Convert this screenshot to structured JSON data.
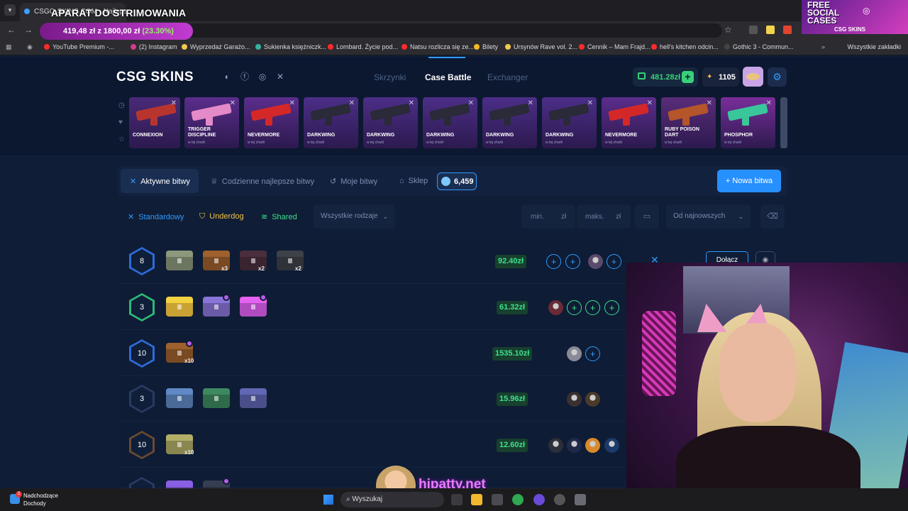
{
  "browser": {
    "tab_title": "CSGO-SKINS.COM - Najlepsze s",
    "stream_title": "APARAT DO STRIMOWANIA",
    "goal_progress": {
      "text": "419,48 zł z 1800,00 zł",
      "percent": "(23.30%)"
    },
    "bookmarks": [
      {
        "label": "YouTube Premium -...",
        "color": "#ff2a2a"
      },
      {
        "label": "(2) Instagram",
        "color": "#d23c8a"
      },
      {
        "label": "Wyprzedaż Garażo...",
        "color": "#f2c94c"
      },
      {
        "label": "Sukienka księżniczk...",
        "color": "#36b3a0"
      },
      {
        "label": "Lombard. Życie pod...",
        "color": "#ff2a2a"
      },
      {
        "label": "Natsu rozlicza się ze...",
        "color": "#ff2a2a"
      },
      {
        "label": "Bilety",
        "color": "#f5b921"
      },
      {
        "label": "Ursynów Rave vol. 2...",
        "color": "#f2c94c"
      },
      {
        "label": "Cennik – Mam Frajd...",
        "color": "#ff2a2a"
      },
      {
        "label": "hell's kitchen odcin...",
        "color": "#ff2a2a"
      },
      {
        "label": "Gothic 3 - Commun...",
        "color": "#444"
      }
    ],
    "all_bookmarks": "Wszystkie zakładki"
  },
  "promo": {
    "title": "FREE SOCIAL CASES",
    "brand": "CSG SKINS"
  },
  "header": {
    "logo": "CSG SKINS",
    "nav": [
      "Skrzynki",
      "Case Battle",
      "Exchanger"
    ],
    "active_nav": "Case Battle",
    "balance": "481.28zł",
    "coins": "1105"
  },
  "drops": [
    {
      "name": "CONNEXION",
      "sub": "",
      "gun": "#b8352f",
      "bg": "#4a2a78"
    },
    {
      "name": "TRIGGER DISCIPLINE",
      "sub": "w tej chwili",
      "gun": "#e58ac8",
      "bg": "#5b2d8c"
    },
    {
      "name": "NEVERMORE",
      "sub": "w tej chwili",
      "gun": "#d42828",
      "bg": "#5b2d8c"
    },
    {
      "name": "DARKWING",
      "sub": "w tej chwili",
      "gun": "#2a2a38",
      "bg": "#4c2e88"
    },
    {
      "name": "DARKWING",
      "sub": "w tej chwili",
      "gun": "#2a2a38",
      "bg": "#4c2e88"
    },
    {
      "name": "DARKWING",
      "sub": "w tej chwili",
      "gun": "#2a2a38",
      "bg": "#4c2e88"
    },
    {
      "name": "DARKWING",
      "sub": "w tej chwili",
      "gun": "#2a2a38",
      "bg": "#4c2e88"
    },
    {
      "name": "DARKWING",
      "sub": "w tej chwili",
      "gun": "#2a2a38",
      "bg": "#4c2e88"
    },
    {
      "name": "NEVERMORE",
      "sub": "w tej chwili",
      "gun": "#d42828",
      "bg": "#5b2d8c"
    },
    {
      "name": "RUBY POISON DART",
      "sub": "w tej chwili",
      "gun": "#b5552a",
      "bg": "#5a2c7a"
    },
    {
      "name": "PHOSPHOR",
      "sub": "w tej chwili",
      "gun": "#39c69a",
      "bg": "#7a2e9a"
    }
  ],
  "battles": {
    "tabs": [
      "Aktywne bitwy",
      "Codzienne najlepsze bitwy",
      "Moje bitwy",
      "Sklep"
    ],
    "gems": "6,459",
    "new_battle": "Nowa bitwa",
    "filters": {
      "standard": "Standardowy",
      "underdog": "Underdog",
      "shared": "Shared"
    },
    "type_select": "Wszystkie rodzaje",
    "min_placeholder": "min.",
    "max_placeholder": "maks.",
    "currency": "zł",
    "sort": "Od najnowszych",
    "join": "Dołącz",
    "rows": [
      {
        "rounds": "8",
        "price": "92.40zł",
        "hex": "#2e6bd8",
        "cases": [
          {
            "c": "#6c7560"
          },
          {
            "c": "#7a4a22",
            "m": "x3"
          },
          {
            "c": "#3a2430",
            "m": "x2"
          },
          {
            "c": "#2f3238",
            "m": "x2"
          }
        ]
      },
      {
        "rounds": "3",
        "price": "61.32zł",
        "hex": "#2fb874",
        "cases": [
          {
            "c": "#c9a233"
          },
          {
            "c": "#6a5aa8",
            "v": true
          },
          {
            "c": "#b04cc0",
            "v": true
          }
        ]
      },
      {
        "rounds": "10",
        "price": "1535.10zł",
        "hex": "#2e6bd8",
        "cases": [
          {
            "c": "#7a4a22",
            "m": "x10",
            "v": true
          }
        ]
      },
      {
        "rounds": "3",
        "price": "15.96zł",
        "hex": "#2a3a60",
        "cases": [
          {
            "c": "#4a6a98"
          },
          {
            "c": "#2f6a4a"
          },
          {
            "c": "#4a4f8a"
          }
        ]
      },
      {
        "rounds": "10",
        "price": "12.60zł",
        "hex": "#6a4a30",
        "cases": [
          {
            "c": "#8a8650",
            "m": "x10"
          }
        ]
      },
      {
        "rounds": "",
        "price": "",
        "hex": "#2a3a60",
        "cases": [
          {
            "c": "#6a4ab0"
          },
          {
            "c": "#2a3040",
            "v": true
          }
        ]
      }
    ]
  },
  "watermark": "hipatty.net",
  "taskbar": {
    "news_title": "Nadchodzące",
    "news_sub": "Dochody",
    "badge": "2",
    "search": "Wyszukaj"
  }
}
